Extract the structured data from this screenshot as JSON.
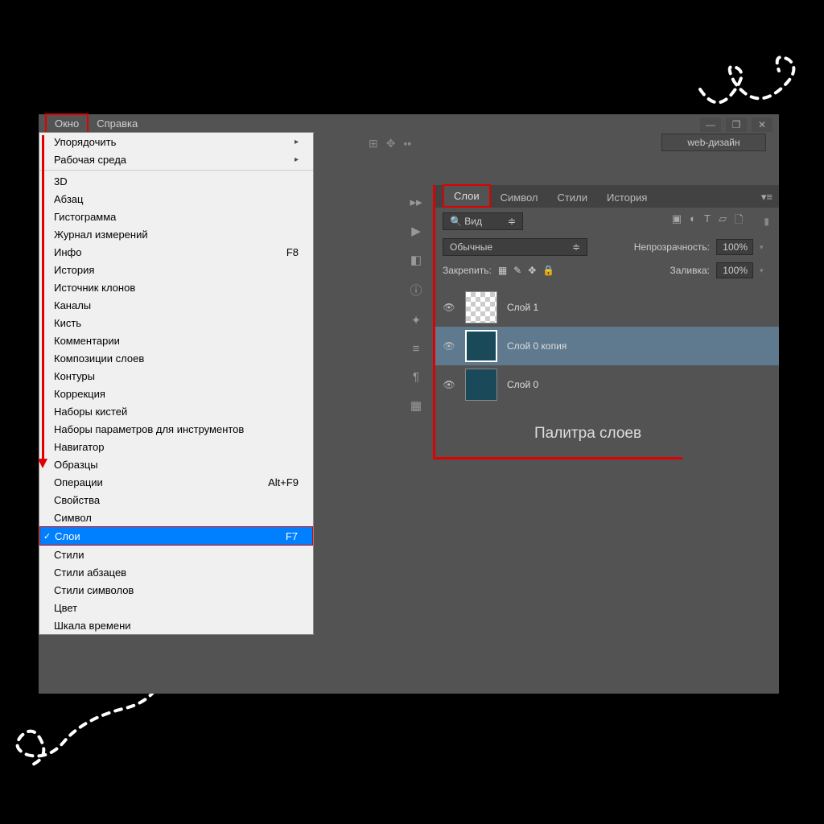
{
  "menubar": {
    "window": "Окно",
    "help": "Справка"
  },
  "workspace": "web-дизайн",
  "dropdown": {
    "arrange": "Упорядочить",
    "workspace": "Рабочая среда",
    "three_d": "3D",
    "paragraph": "Абзац",
    "histogram": "Гистограмма",
    "measurement_log": "Журнал измерений",
    "info": "Инфо",
    "info_sc": "F8",
    "history": "История",
    "clone_source": "Источник клонов",
    "channels": "Каналы",
    "brush": "Кисть",
    "notes": "Комментарии",
    "layer_comps": "Композиции слоев",
    "paths": "Контуры",
    "adjustments": "Коррекция",
    "brush_presets": "Наборы кистей",
    "tool_presets": "Наборы параметров для инструментов",
    "navigator": "Навигатор",
    "swatches": "Образцы",
    "actions": "Операции",
    "actions_sc": "Alt+F9",
    "properties": "Свойства",
    "character": "Символ",
    "layers": "Слои",
    "layers_sc": "F7",
    "styles": "Стили",
    "para_styles": "Стили абзацев",
    "char_styles": "Стили символов",
    "color": "Цвет",
    "timeline": "Шкала времени"
  },
  "panel": {
    "tabs": {
      "layers": "Слои",
      "character": "Символ",
      "styles": "Стили",
      "history": "История"
    },
    "filter_search": "Вид",
    "blend_mode": "Обычные",
    "opacity_label": "Непрозрачность:",
    "opacity_val": "100%",
    "lock_label": "Закрепить:",
    "fill_label": "Заливка:",
    "fill_val": "100%",
    "layers": [
      {
        "name": "Слой 1"
      },
      {
        "name": "Слой 0 копия"
      },
      {
        "name": "Слой 0"
      }
    ]
  },
  "annotation": "Палитра слоев"
}
